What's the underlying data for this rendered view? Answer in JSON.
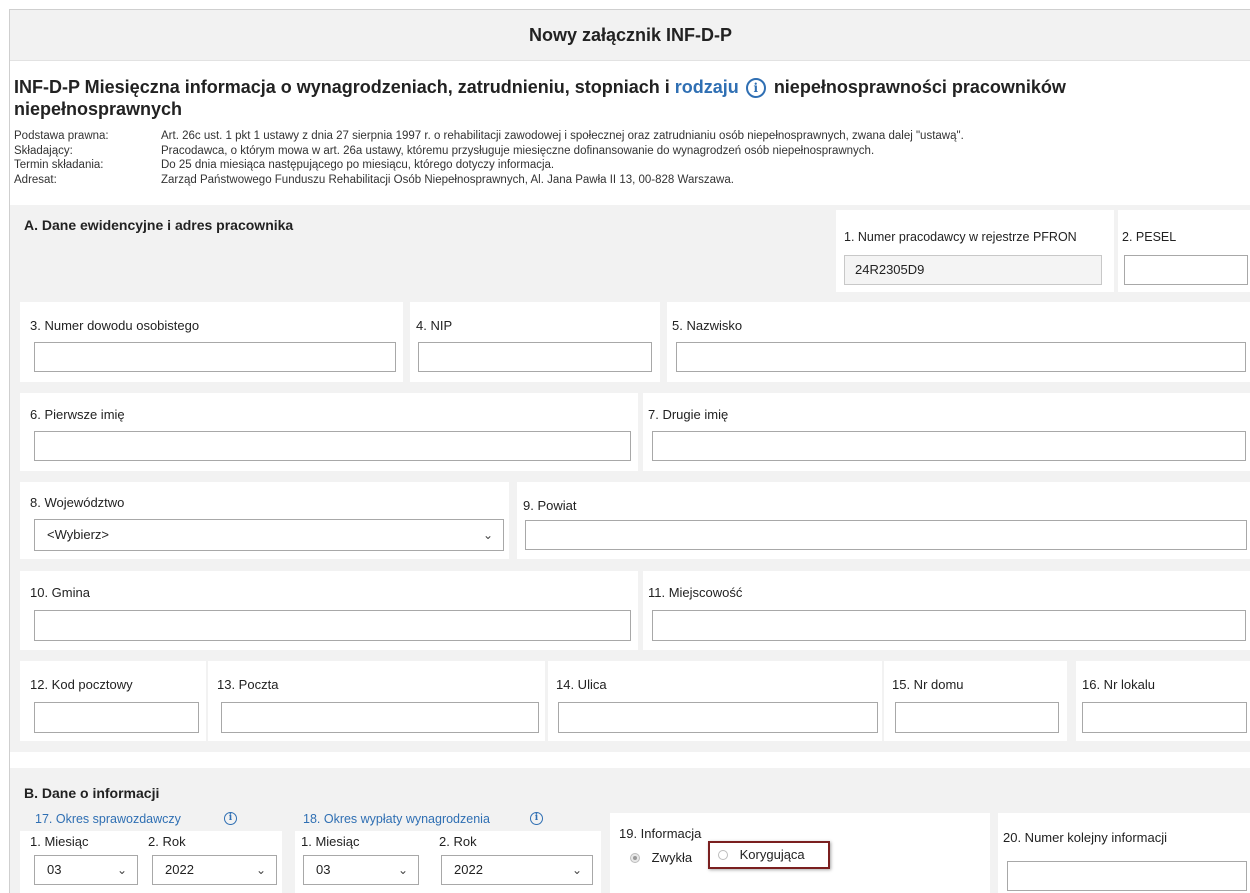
{
  "header": {
    "title": "Nowy załącznik INF-D-P"
  },
  "form_title": {
    "part1": "INF-D-P Miesięczna informacja o wynagrodzeniach, zatrudnieniu, stopniach i ",
    "link": "rodzaju",
    "part2": " niepełnosprawności pracowników niepełnosprawnych"
  },
  "meta": [
    {
      "key": "Podstawa prawna:",
      "value": "Art. 26c ust. 1 pkt 1 ustawy z dnia 27 sierpnia 1997 r. o rehabilitacji zawodowej i społecznej oraz zatrudnianiu osób niepełnosprawnych, zwana dalej \"ustawą\"."
    },
    {
      "key": "Składający:",
      "value": "Pracodawca, o którym mowa w art. 26a ustawy, któremu przysługuje miesięczne dofinansowanie do wynagrodzeń osób niepełnosprawnych."
    },
    {
      "key": "Termin składania:",
      "value": "Do 25 dnia miesiąca następującego po miesiącu, którego dotyczy informacja."
    },
    {
      "key": "Adresat:",
      "value": "Zarząd Państwowego Funduszu Rehabilitacji Osób Niepełnosprawnych, Al. Jana Pawła II 13, 00-828 Warszawa."
    }
  ],
  "section_a": {
    "title": "A. Dane ewidencyjne i adres pracownika",
    "fields": {
      "employer_number": {
        "label": "1. Numer pracodawcy w rejestrze PFRON",
        "value": "24R2305D9"
      },
      "pesel": {
        "label": "2. PESEL",
        "value": ""
      },
      "id_number": {
        "label": "3. Numer dowodu osobistego",
        "value": ""
      },
      "nip": {
        "label": "4. NIP",
        "value": ""
      },
      "surname": {
        "label": "5. Nazwisko",
        "value": ""
      },
      "first_name": {
        "label": "6. Pierwsze imię",
        "value": ""
      },
      "second_name": {
        "label": "7. Drugie imię",
        "value": ""
      },
      "voivodeship": {
        "label": "8. Województwo",
        "value": "<Wybierz>"
      },
      "county": {
        "label": "9. Powiat",
        "value": ""
      },
      "commune": {
        "label": "10. Gmina",
        "value": ""
      },
      "locality": {
        "label": "11. Miejscowość",
        "value": ""
      },
      "postal_code": {
        "label": "12. Kod pocztowy",
        "value": ""
      },
      "post_office": {
        "label": "13. Poczta",
        "value": ""
      },
      "street": {
        "label": "14. Ulica",
        "value": ""
      },
      "house_no": {
        "label": "15. Nr domu",
        "value": ""
      },
      "flat_no": {
        "label": "16. Nr lokalu",
        "value": ""
      }
    }
  },
  "section_b": {
    "title": "B. Dane o informacji",
    "reporting_period": {
      "label": "17. Okres sprawozdawczy",
      "month_label": "1. Miesiąc",
      "month": "03",
      "year_label": "2. Rok",
      "year": "2022"
    },
    "payment_period": {
      "label": "18. Okres wypłaty wynagrodzenia",
      "month_label": "1. Miesiąc",
      "month": "03",
      "year_label": "2. Rok",
      "year": "2022"
    },
    "information": {
      "label": "19. Informacja",
      "option1": "Zwykła",
      "option2": "Korygująca",
      "selected": "Zwykła"
    },
    "sequence_number": {
      "label": "20. Numer kolejny informacji",
      "value": ""
    }
  },
  "colors": {
    "accent": "#2f6fb3",
    "highlight_border": "#7a1f1f",
    "panel_bg": "#f2f2f2"
  }
}
